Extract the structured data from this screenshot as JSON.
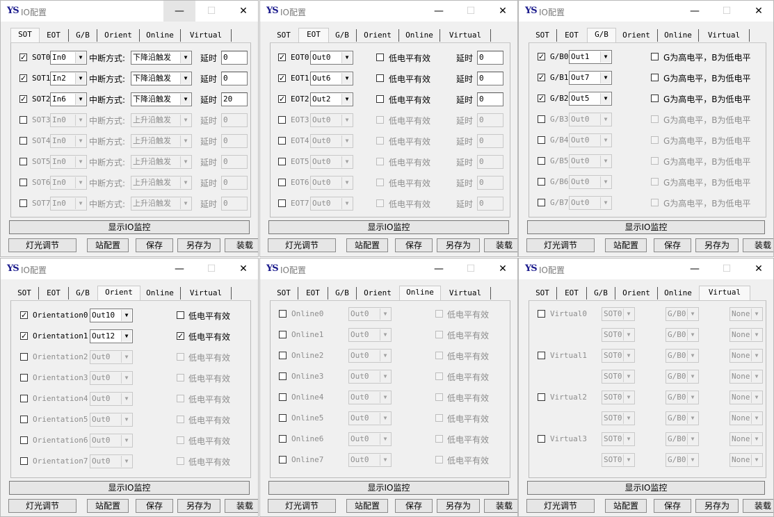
{
  "title": "IO配置",
  "logo": "YS",
  "controls": {
    "minimize": "—",
    "maximize": "☐",
    "close": "✕"
  },
  "tabs": [
    "SOT",
    "EOT",
    "G/B",
    "Orient",
    "Online",
    "Virtual"
  ],
  "footer": {
    "monitor": "显示IO监控",
    "light": "灯光调节",
    "station": "站配置",
    "save": "保存",
    "saveas": "另存为",
    "load": "装载"
  },
  "sot": {
    "mode_label": "中断方式:",
    "delay_label": "延时",
    "rows": [
      {
        "name": "SOT0",
        "checked": true,
        "input": "In0",
        "mode": "下降沿触发",
        "delay": "0"
      },
      {
        "name": "SOT1",
        "checked": true,
        "input": "In2",
        "mode": "下降沿触发",
        "delay": "0"
      },
      {
        "name": "SOT2",
        "checked": true,
        "input": "In6",
        "mode": "下降沿触发",
        "delay": "20"
      },
      {
        "name": "SOT3",
        "checked": false,
        "input": "In0",
        "mode": "上升沿触发",
        "delay": "0"
      },
      {
        "name": "SOT4",
        "checked": false,
        "input": "In0",
        "mode": "上升沿触发",
        "delay": "0"
      },
      {
        "name": "SOT5",
        "checked": false,
        "input": "In0",
        "mode": "上升沿触发",
        "delay": "0"
      },
      {
        "name": "SOT6",
        "checked": false,
        "input": "In0",
        "mode": "上升沿触发",
        "delay": "0"
      },
      {
        "name": "SOT7",
        "checked": false,
        "input": "In0",
        "mode": "上升沿触发",
        "delay": "0"
      }
    ]
  },
  "eot": {
    "low_label": "低电平有效",
    "delay_label": "延时",
    "rows": [
      {
        "name": "EOT0",
        "checked": true,
        "output": "Out0",
        "low": false,
        "delay": "0"
      },
      {
        "name": "EOT1",
        "checked": true,
        "output": "Out6",
        "low": false,
        "delay": "0"
      },
      {
        "name": "EOT2",
        "checked": true,
        "output": "Out2",
        "low": false,
        "delay": "0"
      },
      {
        "name": "EOT3",
        "checked": false,
        "output": "Out0",
        "low": false,
        "delay": "0"
      },
      {
        "name": "EOT4",
        "checked": false,
        "output": "Out0",
        "low": false,
        "delay": "0"
      },
      {
        "name": "EOT5",
        "checked": false,
        "output": "Out0",
        "low": false,
        "delay": "0"
      },
      {
        "name": "EOT6",
        "checked": false,
        "output": "Out0",
        "low": false,
        "delay": "0"
      },
      {
        "name": "EOT7",
        "checked": false,
        "output": "Out0",
        "low": false,
        "delay": "0"
      }
    ]
  },
  "gb": {
    "high_label": "G为高电平，B为低电平",
    "rows": [
      {
        "name": "G/B0",
        "checked": true,
        "output": "Out1",
        "high": false
      },
      {
        "name": "G/B1",
        "checked": true,
        "output": "Out7",
        "high": false
      },
      {
        "name": "G/B2",
        "checked": true,
        "output": "Out5",
        "high": false
      },
      {
        "name": "G/B3",
        "checked": false,
        "output": "Out0",
        "high": false
      },
      {
        "name": "G/B4",
        "checked": false,
        "output": "Out0",
        "high": false
      },
      {
        "name": "G/B5",
        "checked": false,
        "output": "Out0",
        "high": false
      },
      {
        "name": "G/B6",
        "checked": false,
        "output": "Out0",
        "high": false
      },
      {
        "name": "G/B7",
        "checked": false,
        "output": "Out0",
        "high": false
      }
    ]
  },
  "orient": {
    "low_label": "低电平有效",
    "rows": [
      {
        "name": "Orientation0",
        "checked": true,
        "output": "Out10",
        "low": false
      },
      {
        "name": "Orientation1",
        "checked": true,
        "output": "Out12",
        "low": true
      },
      {
        "name": "Orientation2",
        "checked": false,
        "output": "Out0",
        "low": false
      },
      {
        "name": "Orientation3",
        "checked": false,
        "output": "Out0",
        "low": false
      },
      {
        "name": "Orientation4",
        "checked": false,
        "output": "Out0",
        "low": false
      },
      {
        "name": "Orientation5",
        "checked": false,
        "output": "Out0",
        "low": false
      },
      {
        "name": "Orientation6",
        "checked": false,
        "output": "Out0",
        "low": false
      },
      {
        "name": "Orientation7",
        "checked": false,
        "output": "Out0",
        "low": false
      }
    ]
  },
  "online": {
    "low_label": "低电平有效",
    "rows": [
      {
        "name": "Online0",
        "checked": false,
        "output": "Out0",
        "low": false
      },
      {
        "name": "Online1",
        "checked": false,
        "output": "Out0",
        "low": false
      },
      {
        "name": "Online2",
        "checked": false,
        "output": "Out0",
        "low": false
      },
      {
        "name": "Online3",
        "checked": false,
        "output": "Out0",
        "low": false
      },
      {
        "name": "Online4",
        "checked": false,
        "output": "Out0",
        "low": false
      },
      {
        "name": "Online5",
        "checked": false,
        "output": "Out0",
        "low": false
      },
      {
        "name": "Online6",
        "checked": false,
        "output": "Out0",
        "low": false
      },
      {
        "name": "Online7",
        "checked": false,
        "output": "Out0",
        "low": false
      }
    ]
  },
  "virtual": {
    "groups": [
      {
        "name": "Virtual0",
        "checked": false,
        "rows": [
          [
            "SOT0",
            "G/B0",
            "None"
          ],
          [
            "SOT0",
            "G/B0",
            "None"
          ]
        ]
      },
      {
        "name": "Virtual1",
        "checked": false,
        "rows": [
          [
            "SOT0",
            "G/B0",
            "None"
          ],
          [
            "SOT0",
            "G/B0",
            "None"
          ]
        ]
      },
      {
        "name": "Virtual2",
        "checked": false,
        "rows": [
          [
            "SOT0",
            "G/B0",
            "None"
          ],
          [
            "SOT0",
            "G/B0",
            "None"
          ]
        ]
      },
      {
        "name": "Virtual3",
        "checked": false,
        "rows": [
          [
            "SOT0",
            "G/B0",
            "None"
          ],
          [
            "SOT0",
            "G/B0",
            "None"
          ]
        ]
      }
    ]
  }
}
